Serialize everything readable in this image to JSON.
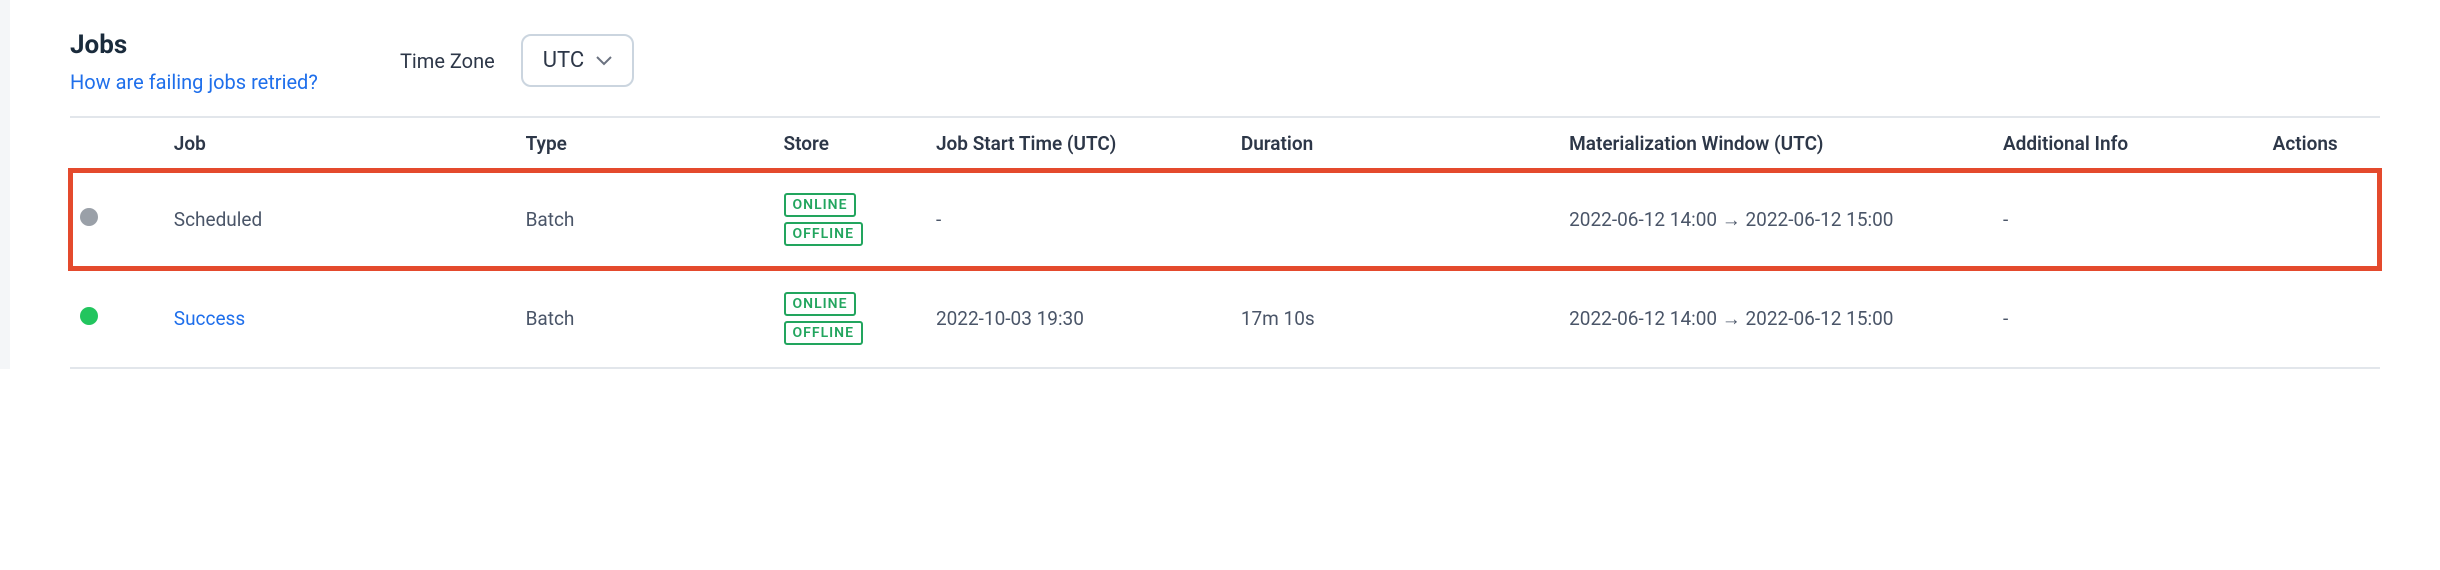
{
  "header": {
    "title": "Jobs",
    "help_link": "How are failing jobs retried?",
    "tz_label": "Time Zone",
    "tz_value": "UTC"
  },
  "columns": {
    "job": "Job",
    "type": "Type",
    "store": "Store",
    "start": "Job Start Time (UTC)",
    "duration": "Duration",
    "mat": "Materialization Window (UTC)",
    "add": "Additional Info",
    "actions": "Actions"
  },
  "store_labels": {
    "online": "ONLINE",
    "offline": "OFFLINE"
  },
  "rows": [
    {
      "status_color": "gray",
      "job": "Scheduled",
      "job_is_link": false,
      "type": "Batch",
      "stores": [
        "online",
        "offline"
      ],
      "start": "-",
      "duration": "",
      "mat": "2022-06-12 14:00 → 2022-06-12 15:00",
      "add": "-",
      "highlighted": true
    },
    {
      "status_color": "green",
      "job": "Success",
      "job_is_link": true,
      "type": "Batch",
      "stores": [
        "online",
        "offline"
      ],
      "start": "2022-10-03 19:30",
      "duration": "17m 10s",
      "mat": "2022-06-12 14:00 → 2022-06-12 15:00",
      "add": "-",
      "highlighted": false
    }
  ]
}
